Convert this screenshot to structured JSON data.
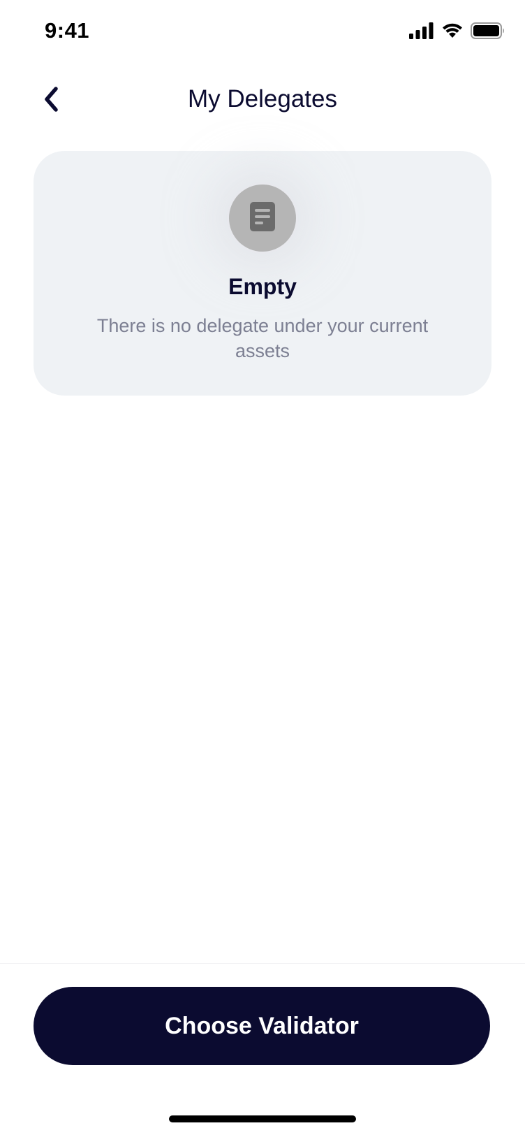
{
  "status_bar": {
    "time": "9:41",
    "icons": [
      "cellular-signal-icon",
      "wifi-icon",
      "battery-icon"
    ]
  },
  "header": {
    "back_icon": "chevron-left-icon",
    "title": "My Delegates"
  },
  "empty_state": {
    "icon": "document-icon",
    "title": "Empty",
    "description": "There is no delegate under your current assets"
  },
  "footer": {
    "primary_button_label": "Choose Validator"
  },
  "colors": {
    "primary": "#0b0b30",
    "card_background": "#eff2f5",
    "muted_text": "#7c7f92",
    "icon_circle": "#b5b5b5",
    "icon_glyph": "#6b6b6b"
  }
}
